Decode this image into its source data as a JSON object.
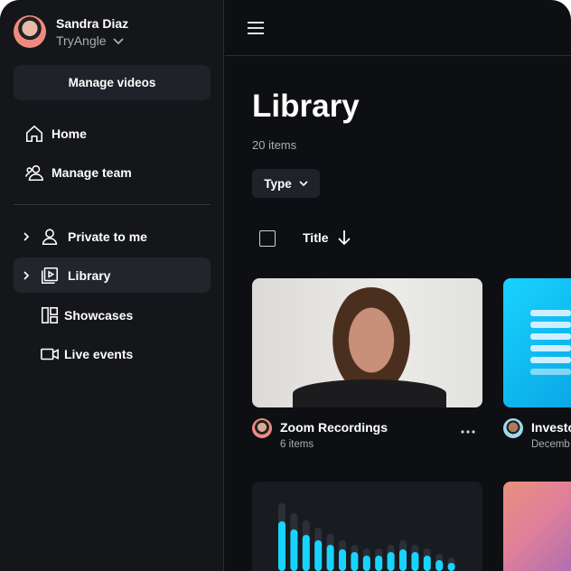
{
  "user": {
    "name": "Sandra Diaz",
    "org": "TryAngle"
  },
  "sidebar": {
    "manage_label": "Manage videos",
    "items": [
      {
        "label": "Home",
        "icon": "home-icon"
      },
      {
        "label": "Manage team",
        "icon": "team-icon"
      }
    ],
    "folders": [
      {
        "label": "Private to me",
        "icon": "person-icon",
        "expandable": true
      },
      {
        "label": "Library",
        "icon": "library-icon",
        "expandable": true,
        "active": true
      },
      {
        "label": "Showcases",
        "icon": "showcase-icon"
      },
      {
        "label": "Live events",
        "icon": "camera-icon"
      }
    ]
  },
  "main": {
    "title": "Library",
    "count": "20 items",
    "filter_label": "Type",
    "sort_label": "Title",
    "cards": [
      {
        "title": "Zoom Recordings",
        "sub": "6 items"
      },
      {
        "title": "Investo",
        "sub": "Decemb"
      }
    ]
  },
  "colors": {
    "accent": "#19d3ff",
    "bg": "#0d0f12",
    "sidebar": "#14161a"
  }
}
